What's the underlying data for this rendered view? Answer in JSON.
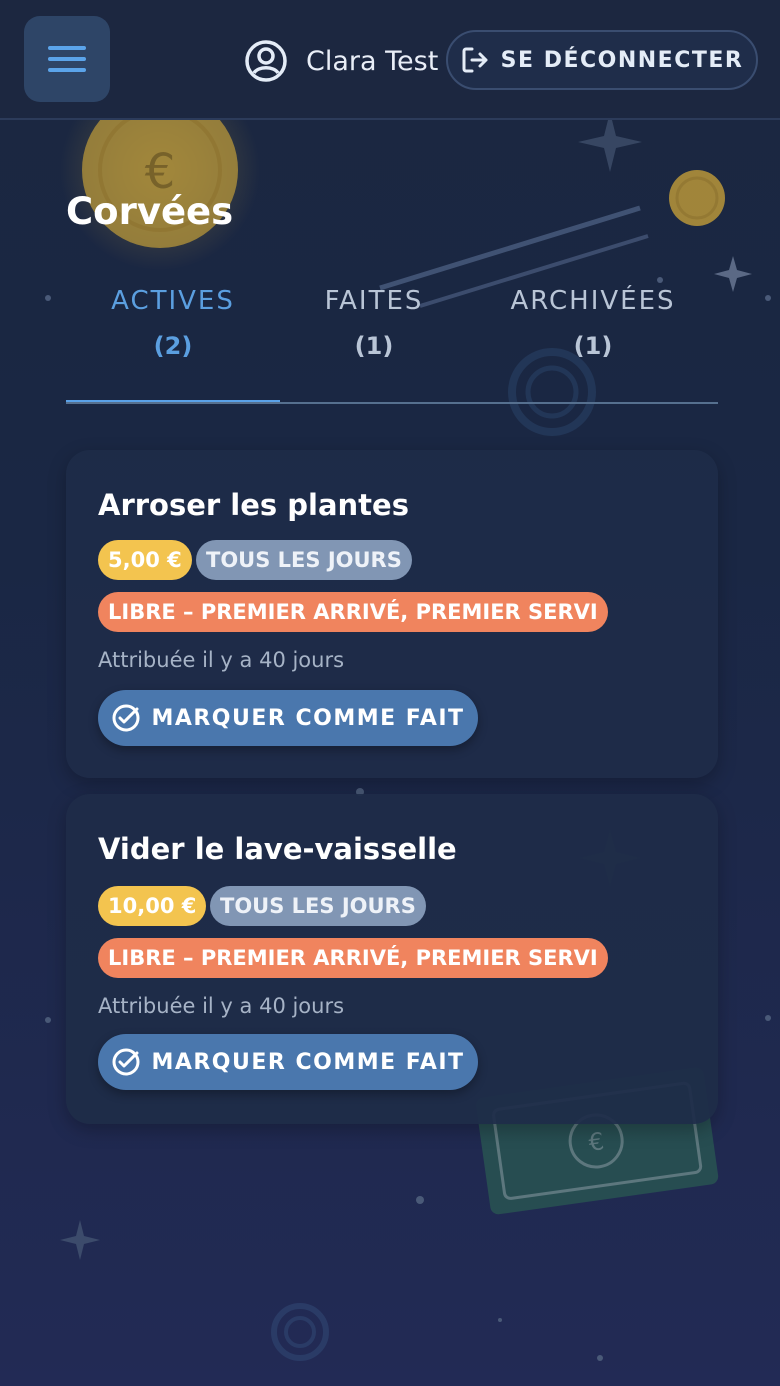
{
  "header": {
    "user_name": "Clara Test",
    "logout_label": "SE DÉCONNECTER",
    "icons": {
      "menu": "menu-icon",
      "user": "user-circle-icon",
      "logout": "logout-icon"
    }
  },
  "page": {
    "title": "Corvées"
  },
  "tabs": [
    {
      "label": "ACTIVES",
      "count": "(2)",
      "active": true
    },
    {
      "label": "FAITES",
      "count": "(1)",
      "active": false
    },
    {
      "label": "ARCHIVÉES",
      "count": "(1)",
      "active": false
    }
  ],
  "chores": [
    {
      "title": "Arroser les plantes",
      "price": "5,00 €",
      "frequency": "TOUS LES JOURS",
      "mode": "LIBRE – PREMIER ARRIVÉ, PREMIER SERVI",
      "assigned": "Attribuée il y a 40 jours",
      "action_label": "MARQUER COMME FAIT"
    },
    {
      "title": "Vider le lave-vaisselle",
      "price": "10,00 €",
      "frequency": "TOUS LES JOURS",
      "mode": "LIBRE – PREMIER ARRIVÉ, PREMIER SERVI",
      "assigned": "Attribuée il y a 40 jours",
      "action_label": "MARQUER COMME FAIT"
    }
  ],
  "background_symbols": {
    "coin_symbol": "€",
    "bill_symbol": "€"
  },
  "colors": {
    "accent": "#5aa1e8",
    "price_chip": "#f3c44f",
    "frequency_chip": "#8196b4",
    "mode_chip": "#f0845e",
    "action_button": "#4a77ad"
  }
}
